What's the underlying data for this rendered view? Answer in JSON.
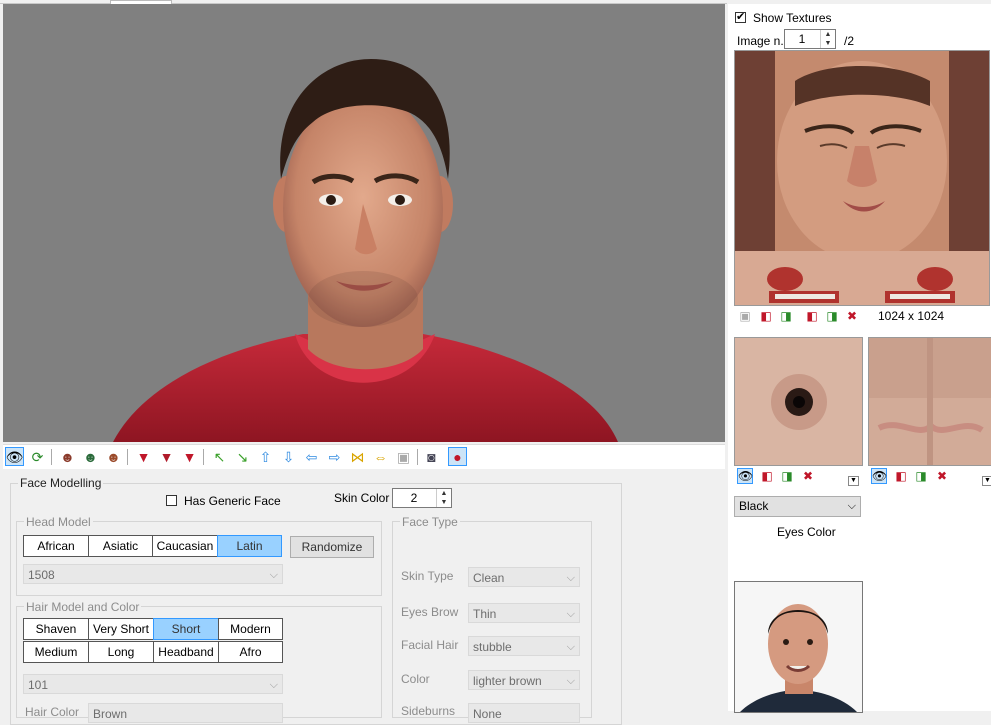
{
  "toolbar_icons": [
    "eye-icon",
    "refresh-icon",
    "head-front-icon",
    "head-green-icon",
    "head-side-icon",
    "shirt-red-icon",
    "shirt-green-icon",
    "shirt-red-x-icon",
    "arrow-up-left-icon",
    "arrow-down-right-icon",
    "arrow-up-icon",
    "arrow-down-icon",
    "arrow-left-icon",
    "arrow-right-icon",
    "shrink-horizontal-icon",
    "expand-horizontal-icon",
    "save-icon",
    "camera-icon",
    "shirt-view-icon"
  ],
  "right": {
    "show_textures_label": "Show Textures",
    "show_textures_checked": true,
    "image_n_label": "Image n.",
    "image_n_value": "1",
    "image_total": "/2",
    "texture_size": "1024 x 1024",
    "eyes_color_value": "Black",
    "eyes_color_label": "Eyes Color"
  },
  "face_modelling": {
    "title": "Face Modelling",
    "generic_face_label": "Has Generic Face",
    "generic_face_checked": false,
    "skin_color_label": "Skin Color",
    "skin_color_value": "2",
    "head_model": {
      "title": "Head Model",
      "buttons": [
        "African",
        "Asiatic",
        "Caucasian",
        "Latin"
      ],
      "selected": "Latin",
      "randomize_label": "Randomize",
      "combo_value": "1508"
    },
    "hair_model": {
      "title": "Hair Model and Color",
      "buttons": [
        "Shaven",
        "Very Short",
        "Short",
        "Modern",
        "Medium",
        "Long",
        "Headband",
        "Afro"
      ],
      "selected": "Short",
      "combo_value": "101",
      "hair_color_label": "Hair Color",
      "hair_color_value": "Brown"
    },
    "face_type": {
      "title": "Face Type",
      "skin_type_label": "Skin Type",
      "skin_type_value": "Clean",
      "eyes_brow_label": "Eyes Brow",
      "eyes_brow_value": "Thin",
      "facial_hair_label": "Facial Hair",
      "facial_hair_value": "stubble",
      "color_label": "Color",
      "color_value": "lighter brown",
      "sideburns_label": "Sideburns",
      "sideburns_value": "None"
    }
  },
  "colors": {
    "viewport_bg": "#808080",
    "selected_button": "#99d1ff",
    "shirt_red": "#b81e2e"
  }
}
